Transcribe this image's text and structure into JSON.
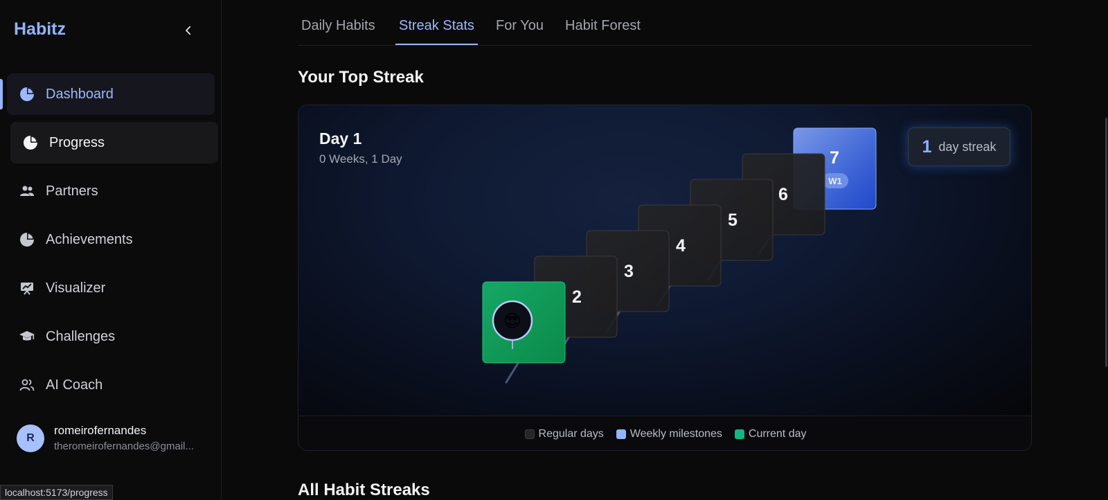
{
  "sidebar": {
    "brand": "Habitz",
    "items": [
      {
        "label": "Dashboard",
        "icon": "pie-chart-icon"
      },
      {
        "label": "Progress",
        "icon": "pie-chart-icon"
      },
      {
        "label": "Partners",
        "icon": "users-icon"
      },
      {
        "label": "Achievements",
        "icon": "pie-chart-icon"
      },
      {
        "label": "Visualizer",
        "icon": "presentation-icon"
      },
      {
        "label": "Challenges",
        "icon": "graduation-cap-icon"
      },
      {
        "label": "AI Coach",
        "icon": "users-outline-icon"
      }
    ],
    "user": {
      "initial": "R",
      "name": "romeirofernandes",
      "email": "theromeirofernandes@gmail..."
    }
  },
  "status_url": "localhost:5173/progress",
  "tabs": [
    "Daily Habits",
    "Streak Stats",
    "For You",
    "Habit Forest"
  ],
  "active_tab": "Streak Stats",
  "sections": {
    "top_streak": "Your Top Streak",
    "all_streaks": "All Habit Streaks"
  },
  "streak_card": {
    "day_title": "Day 1",
    "day_sub": "0 Weeks, 1 Day",
    "streak_number": "1",
    "streak_label": "day streak",
    "steps": [
      "2",
      "3",
      "4",
      "5",
      "6",
      "7"
    ],
    "milestone_label": "W1",
    "avatar_emoji": "😎"
  },
  "legend": [
    "Regular days",
    "Weekly milestones",
    "Current day"
  ],
  "colors": {
    "accent": "#93b4ff",
    "current_day": "#10b981",
    "milestone": "#4f7fff",
    "regular": "#262628"
  }
}
